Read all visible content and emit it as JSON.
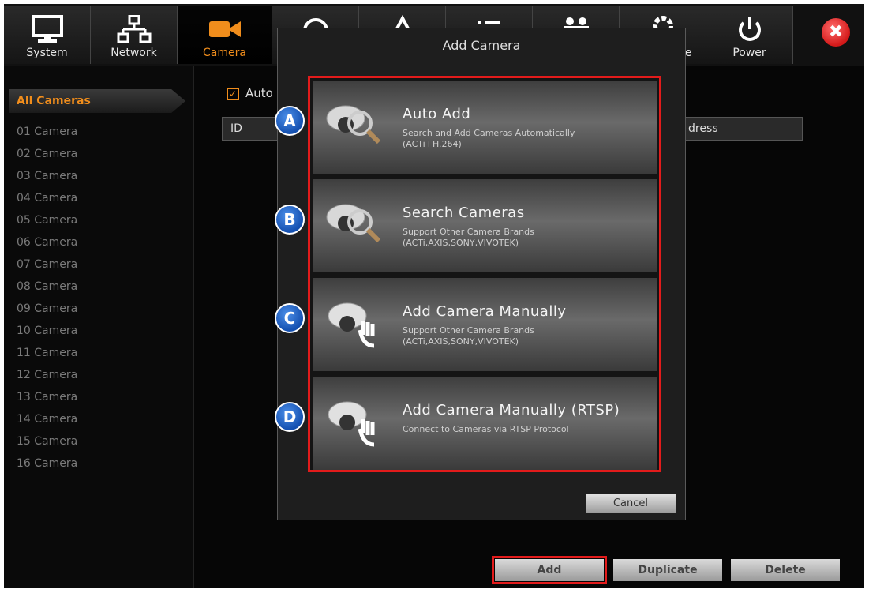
{
  "toolbar": {
    "items": [
      {
        "label": "System",
        "icon": "monitor-icon"
      },
      {
        "label": "Network",
        "icon": "network-icon"
      },
      {
        "label": "Camera",
        "icon": "camera-icon",
        "active": true
      },
      {
        "label": "",
        "icon": "clock-icon"
      },
      {
        "label": "",
        "icon": "alert-icon"
      },
      {
        "label": "",
        "icon": "list-icon"
      },
      {
        "label": "",
        "icon": "users-icon"
      },
      {
        "label": "ance",
        "icon": "gear-icon"
      },
      {
        "label": "Power",
        "icon": "power-icon"
      }
    ],
    "close_symbol": "✖"
  },
  "sidebar": {
    "all_label": "All Cameras",
    "items": [
      "01 Camera",
      "02 Camera",
      "03 Camera",
      "04 Camera",
      "05 Camera",
      "06 Camera",
      "07 Camera",
      "08 Camera",
      "09 Camera",
      "10 Camera",
      "11 Camera",
      "12 Camera",
      "13 Camera",
      "14 Camera",
      "15 Camera",
      "16 Camera"
    ]
  },
  "main": {
    "auto_checkbox_label": "Auto",
    "auto_checked": true,
    "table_header": {
      "id": "ID",
      "address": "dress"
    }
  },
  "dialog": {
    "title": "Add Camera",
    "options": [
      {
        "badge": "A",
        "title": "Auto Add",
        "desc": "Search and Add Cameras Automatically\n(ACTi+H.264)",
        "icon": "camera-search-icon"
      },
      {
        "badge": "B",
        "title": "Search Cameras",
        "desc": "Support Other Camera Brands\n(ACTi,AXIS,SONY,VIVOTEK)",
        "icon": "camera-search-icon"
      },
      {
        "badge": "C",
        "title": "Add Camera Manually",
        "desc": "Support Other Camera Brands\n(ACTi,AXIS,SONY,VIVOTEK)",
        "icon": "camera-hand-icon"
      },
      {
        "badge": "D",
        "title": "Add Camera Manually (RTSP)",
        "desc": "Connect to Cameras via RTSP Protocol",
        "icon": "camera-hand-icon"
      }
    ],
    "cancel_label": "Cancel"
  },
  "bottom_buttons": {
    "add": "Add",
    "duplicate": "Duplicate",
    "delete": "Delete"
  },
  "colors": {
    "accent": "#f08d1c",
    "highlight": "#e21b1b",
    "badge": "#1e5fc4"
  }
}
